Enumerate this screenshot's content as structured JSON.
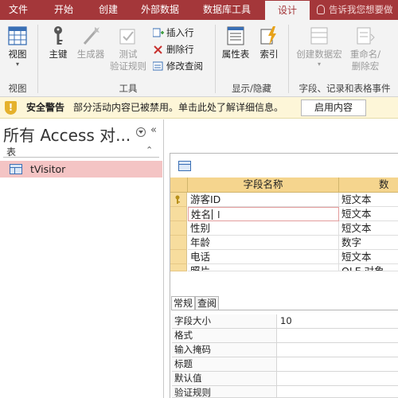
{
  "tabs": [
    "文件",
    "开始",
    "创建",
    "外部数据",
    "数据库工具",
    "设计"
  ],
  "active_tab": "设计",
  "tell_me": "告诉我您想要做",
  "ribbon": {
    "view": "视图",
    "view_group": "视图",
    "primary_key": "主键",
    "builder": "生成器",
    "test_rules": [
      "测试",
      "验证规则"
    ],
    "insert_row": "插入行",
    "delete_row": "删除行",
    "modify_lookup": "修改查阅",
    "tools_group": "工具",
    "property_sheet": "属性表",
    "indexes": "索引",
    "show_hide_group": "显示/隐藏",
    "create_macro": [
      "创建数据宏",
      "▾"
    ],
    "rename_macro": [
      "重命名/",
      "删除宏"
    ],
    "field_events_group": "字段、记录和表格事件"
  },
  "security": {
    "title": "安全警告",
    "message": "部分活动内容已被禁用。单击此处了解详细信息。",
    "button": "启用内容"
  },
  "nav": {
    "title": "所有 Access 对...",
    "group": "表",
    "item": "tVisitor"
  },
  "grid": {
    "headers": [
      "字段名称",
      "数据"
    ],
    "rows": [
      [
        "游客ID",
        "短文本"
      ],
      [
        "姓名",
        "短文本"
      ],
      [
        "性别",
        "短文本"
      ],
      [
        "年龄",
        "数字"
      ],
      [
        "电话",
        "短文本"
      ],
      [
        "照片",
        "OLE 对象"
      ]
    ]
  },
  "props": {
    "tabs": [
      "常规",
      "查阅"
    ],
    "rows": [
      [
        "字段大小",
        "10"
      ],
      [
        "格式",
        ""
      ],
      [
        "输入掩码",
        ""
      ],
      [
        "标题",
        ""
      ],
      [
        "默认值",
        ""
      ],
      [
        "验证规则",
        ""
      ]
    ]
  },
  "colors": {
    "accent": "#a4373a",
    "message_bar": "#fdf6d8",
    "grid_header": "#f5d58e",
    "nav_selected": "#f4c4c4"
  }
}
